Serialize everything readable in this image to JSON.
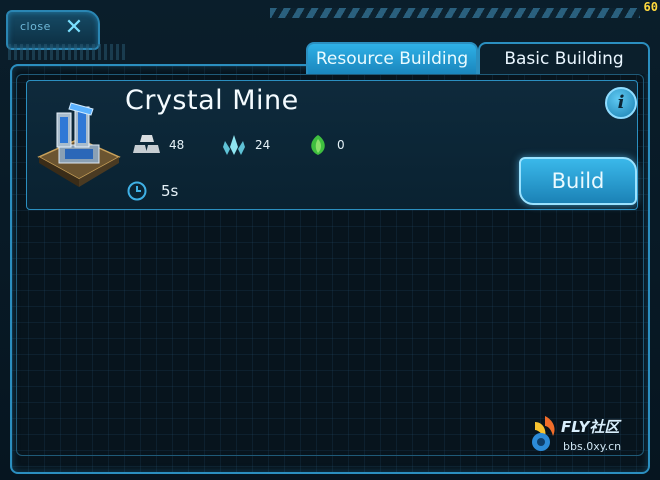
{
  "hud": {
    "close_label": "close",
    "fps": "60"
  },
  "tabs": [
    {
      "label": "Resource Building",
      "active": true
    },
    {
      "label": "Basic Building",
      "active": false
    }
  ],
  "building": {
    "name": "Crystal Mine",
    "info_icon": "info-icon",
    "costs": [
      {
        "resource": "metal",
        "icon": "metal-bars-icon",
        "value": "48"
      },
      {
        "resource": "crystal",
        "icon": "crystal-icon",
        "value": "24"
      },
      {
        "resource": "energy",
        "icon": "leaf-icon",
        "value": "0"
      }
    ],
    "time": "5s",
    "action_label": "Build"
  },
  "watermark": {
    "title": "FLY社区",
    "subtitle": "bbs.0xy.cn"
  },
  "colors": {
    "accent": "#2b8fc0",
    "button": "#3ab8ea",
    "background": "#05121b",
    "fps": "#ffd93d"
  }
}
